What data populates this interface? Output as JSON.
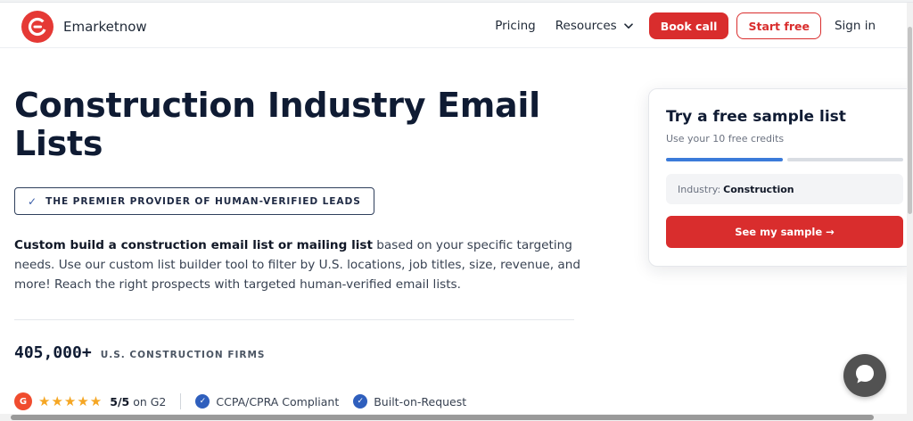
{
  "brand": {
    "name": "Emarketnow",
    "accent": "#d92d2d"
  },
  "nav": {
    "pricing": "Pricing",
    "resources": "Resources",
    "book_call": "Book call",
    "start_free": "Start free",
    "sign_in": "Sign in"
  },
  "hero": {
    "title": "Construction Industry Email Lists",
    "badge": "THE PREMIER PROVIDER OF HUMAN-VERIFIED LEADS",
    "desc_bold": "Custom build a construction email list or mailing list",
    "desc_rest": " based on your specific targeting needs. Use our custom list builder tool to filter by U.S. locations, job titles, size, revenue, and more! Reach the right prospects with targeted human-verified email lists."
  },
  "stat": {
    "number": "405,000+",
    "label": "U.S. CONSTRUCTION FIRMS"
  },
  "trust": {
    "g2_logo": "G",
    "stars": "★★★★★",
    "rating_value": "5/5",
    "rating_suffix": " on G2",
    "ccpa": "CCPA/CPRA Compliant",
    "built": "Built-on-Request"
  },
  "sample_card": {
    "title": "Try a free sample list",
    "subtitle": "Use your 10 free credits",
    "progress_fraction": 0.5,
    "field_label": "Industry:",
    "field_value": "Construction",
    "cta": "See my sample →"
  },
  "icons": {
    "logo": "e-logo-icon",
    "chevron": "chevron-down-icon",
    "check": "check-icon",
    "chat": "chat-bubble-icon"
  }
}
